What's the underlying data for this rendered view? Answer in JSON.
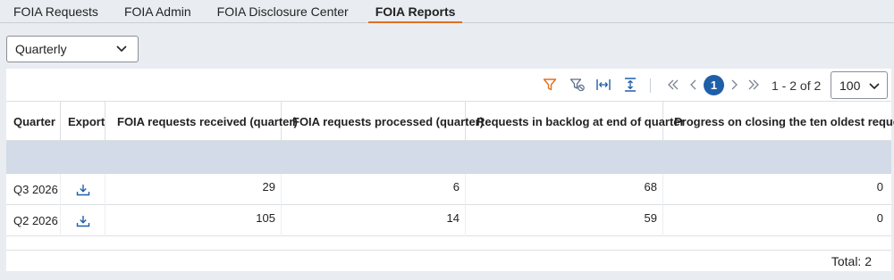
{
  "tabs": [
    {
      "label": "FOIA Requests"
    },
    {
      "label": "FOIA Admin"
    },
    {
      "label": "FOIA Disclosure Center"
    },
    {
      "label": "FOIA Reports",
      "active": true
    }
  ],
  "period_select": {
    "value": "Quarterly"
  },
  "toolbar": {
    "icons": [
      "filter-icon",
      "clear-filter-icon",
      "fit-columns-icon",
      "expand-rows-icon"
    ],
    "pager": {
      "current_page": "1",
      "range_text": "1 - 2 of 2",
      "page_size": "100"
    }
  },
  "columns": [
    "Quarter",
    "Export",
    "FOIA requests received (quarter)",
    "FOIA requests processed (quarter)",
    "Requests in backlog at end of quarter",
    "Progress on closing the ten oldest requests"
  ],
  "rows": [
    {
      "quarter": "Q3 2026",
      "received": "29",
      "processed": "6",
      "backlog": "68",
      "progress": "0"
    },
    {
      "quarter": "Q2 2026",
      "received": "105",
      "processed": "14",
      "backlog": "59",
      "progress": "0"
    }
  ],
  "footer": {
    "total": "Total: 2"
  },
  "colors": {
    "accent": "#e0701e",
    "primary": "#1f5fa9",
    "filter_row": "#d2dbe7",
    "background": "#e9edf2"
  }
}
